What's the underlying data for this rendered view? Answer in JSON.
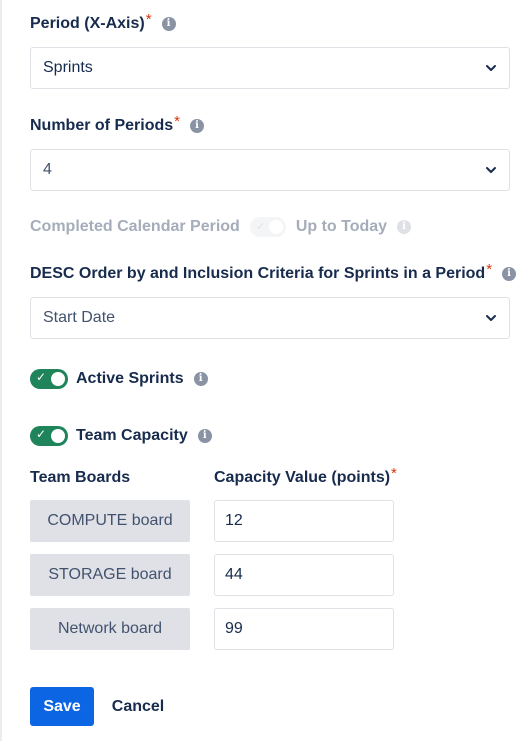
{
  "period": {
    "label": "Period (X-Axis)",
    "required_mark": "*",
    "value": "Sprints"
  },
  "number_of_periods": {
    "label": "Number of Periods",
    "required_mark": "*",
    "value": "4"
  },
  "calendar_toggle": {
    "left_label": "Completed Calendar Period",
    "right_label": "Up to Today",
    "enabled": false
  },
  "order": {
    "label": "DESC Order by and Inclusion Criteria for Sprints in a Period",
    "required_mark": "*",
    "value": "Start Date"
  },
  "active_sprints": {
    "label": "Active Sprints",
    "on": true
  },
  "team_capacity": {
    "label": "Team Capacity",
    "on": true
  },
  "capacity_table": {
    "col_boards": "Team Boards",
    "col_value": "Capacity Value (points)",
    "required_mark": "*",
    "rows": [
      {
        "board": "COMPUTE board",
        "value": "12"
      },
      {
        "board": "STORAGE board",
        "value": "44"
      },
      {
        "board": "Network board",
        "value": "99"
      }
    ]
  },
  "actions": {
    "save": "Save",
    "cancel": "Cancel"
  },
  "colors": {
    "primary": "#0c66e4",
    "toggle_on": "#1f845a",
    "required": "#de350b"
  }
}
